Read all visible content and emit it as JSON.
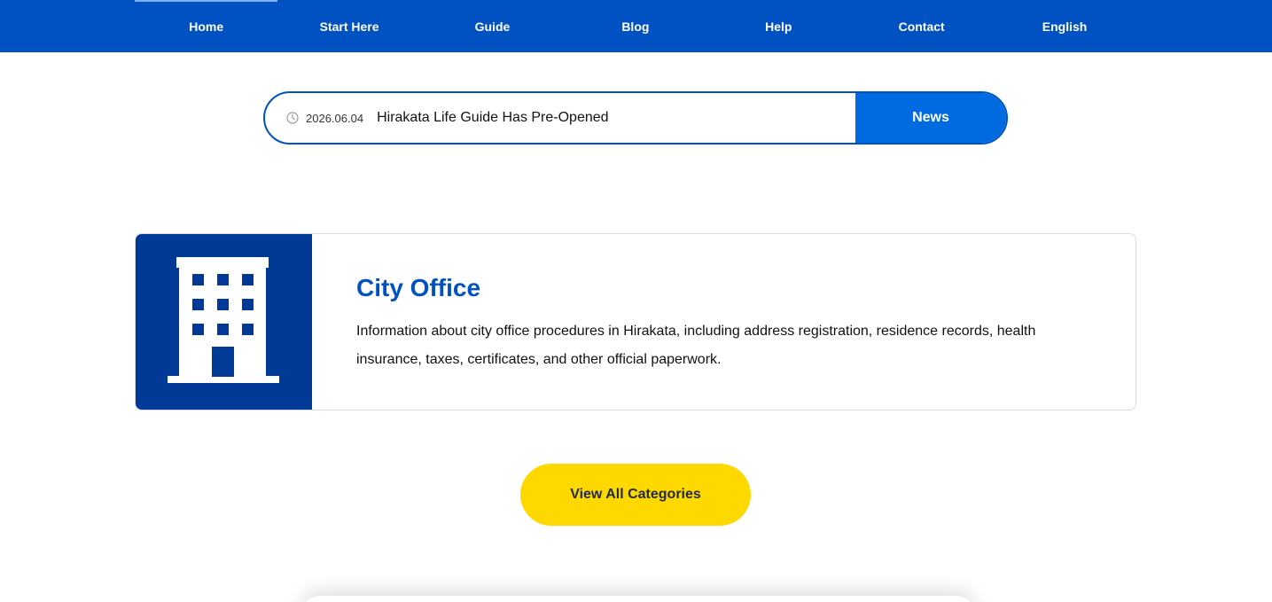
{
  "nav": {
    "items": [
      {
        "label": "Home"
      },
      {
        "label": "Start Here"
      },
      {
        "label": "Guide"
      },
      {
        "label": "Blog"
      },
      {
        "label": "Help"
      },
      {
        "label": "Contact"
      },
      {
        "label": "English"
      }
    ],
    "active_index": 0
  },
  "news": {
    "icon": "clock-icon",
    "date": "2026.06.04",
    "title": "Hirakata Life Guide Has Pre-Opened",
    "button_label": "News"
  },
  "category": {
    "icon": "building-icon",
    "title": "City Office",
    "description": "Information about city office procedures in Hirakata, including address registration, residence records, health insurance, taxes, certificates, and other official paperwork."
  },
  "cta": {
    "label": "View All Categories"
  },
  "colors": {
    "nav_bg": "#0052c2",
    "accent_blue": "#006ae0",
    "icon_box_bg": "#003a96",
    "cta_yellow": "#ffd800"
  }
}
